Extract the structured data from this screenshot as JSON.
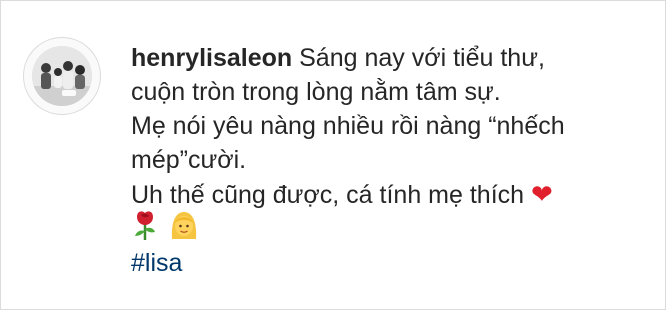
{
  "comment": {
    "username": "henrylisaleon",
    "lines": [
      "Sáng nay với tiểu thư,",
      "cuộn tròn trong lòng nằm tâm sự.",
      "Mẹ nói yêu nàng nhiều rồi nàng “nhếch",
      "mép”cười.",
      "Uh thế cũng được, cá tính mẹ thích"
    ],
    "heart_glyph": "❤",
    "emojis": [
      "rose-emoji",
      "blond-woman-emoji"
    ],
    "hashtag": "#lisa"
  },
  "colors": {
    "text": "#262626",
    "hashtag": "#00376b",
    "heart": "#e0202c",
    "border": "#dbdbdb"
  }
}
